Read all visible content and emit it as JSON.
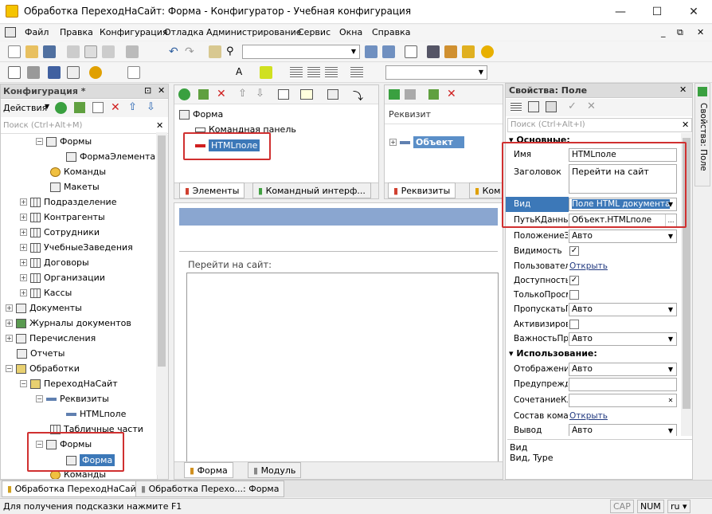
{
  "window": {
    "title": "Обработка ПереходНаСайт: Форма - Конфигуратор - Учебная конфигурация"
  },
  "menu": [
    "Файл",
    "Правка",
    "Конфигурация",
    "Отладка",
    "Администрирование",
    "Сервис",
    "Окна",
    "Справка"
  ],
  "config_panel": {
    "title": "Конфигурация *",
    "actions": "Действия",
    "search_placeholder": "Поиск (Ctrl+Alt+M)",
    "tree": [
      "Формы",
      "ФормаЭлемента",
      "Команды",
      "Макеты",
      "Подразделение",
      "Контрагенты",
      "Сотрудники",
      "УчебныеЗаведения",
      "Договоры",
      "Организации",
      "Кассы",
      "Документы",
      "Журналы документов",
      "Перечисления",
      "Отчеты",
      "Обработки",
      "ПереходНаСайт",
      "Реквизиты",
      "HTMLполе",
      "Табличные части",
      "Формы",
      "Форма",
      "Команды"
    ]
  },
  "form_editor": {
    "elements": [
      "Форма",
      "Командная панель",
      "HTMLполе"
    ],
    "tab_elements": "Элементы",
    "tab_cmd": "Командный интерф...",
    "attr_header": "Реквизит",
    "attr_object": "Объект",
    "tab_attrs": "Реквизиты",
    "tab_com": "Ком",
    "preview_label": "Перейти на сайт:",
    "tab_form": "Форма",
    "tab_module": "Модуль"
  },
  "properties": {
    "title": "Свойства: Поле",
    "search_placeholder": "Поиск (Ctrl+Alt+I)",
    "section_main": "Основные:",
    "section_use": "Использование:",
    "rows": {
      "name_lbl": "Имя",
      "name_val": "HTMLполе",
      "header_lbl": "Заголовок",
      "header_val": "Перейти на сайт",
      "kind_lbl": "Вид",
      "kind_val": "Поле HTML документа",
      "path_lbl": "ПутьКДанным",
      "path_val": "Объект.HTMLполе",
      "pos_lbl": "ПоложениеЗаголовка",
      "pos_val": "Авто",
      "vis_lbl": "Видимость",
      "user_lbl": "Пользовательская видимость",
      "user_val": "Открыть",
      "avail_lbl": "Доступность",
      "ro_lbl": "ТолькоПросмотр",
      "skip_lbl": "ПропускатьПриВводе",
      "skip_val": "Авто",
      "act_lbl": "Активизировать",
      "imp_lbl": "ВажностьПриОтображении",
      "imp_val": "Авто",
      "disp_lbl": "Отображение",
      "disp_val": "Авто",
      "warn_lbl": "Предупреждение",
      "shortcut_lbl": "СочетаниеКлавиш",
      "cmd_lbl": "Состав команд",
      "cmd_val": "Открыть",
      "out_lbl": "Вывод",
      "out_val": "Авто"
    },
    "help1": "Вид",
    "help2": "Вид, Type"
  },
  "side_tab": "Свойства: Поле",
  "window_tabs": [
    "Обработка ПереходНаСайт",
    "Обработка Перехо...: Форма"
  ],
  "status": {
    "hint": "Для получения подсказки нажмите F1",
    "cap": "CAP",
    "num": "NUM",
    "lang": "ru"
  }
}
